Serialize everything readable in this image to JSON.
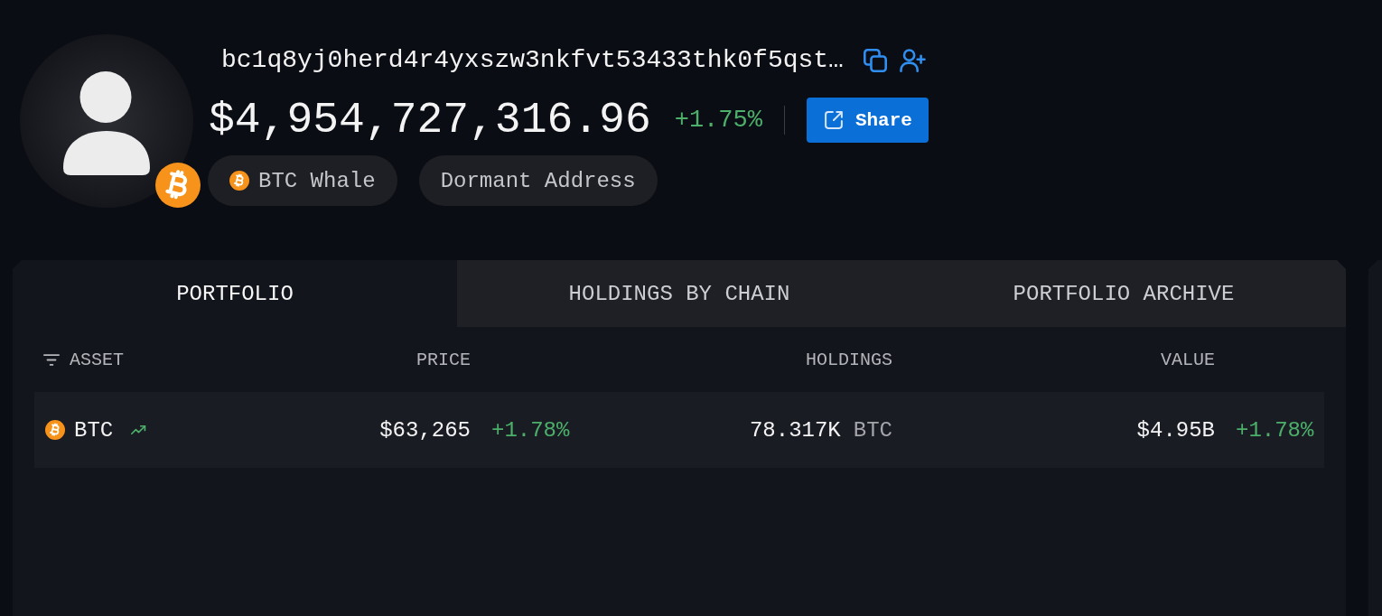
{
  "profile": {
    "address": "bc1q8yj0herd4r4yxszw3nkfvt53433thk0f5qst…",
    "balance": "$4,954,727,316.96",
    "change": "+1.75%",
    "share_button": "Share",
    "tags": [
      {
        "label": "BTC Whale",
        "kind": "coin"
      },
      {
        "label": "Dormant Address",
        "kind": "plain"
      }
    ]
  },
  "tabs": [
    {
      "label": "PORTFOLIO",
      "selected": true
    },
    {
      "label": "HOLDINGS BY CHAIN",
      "selected": false
    },
    {
      "label": "PORTFOLIO ARCHIVE",
      "selected": false
    }
  ],
  "table": {
    "columns": [
      {
        "label": "ASSET",
        "kind": "filter"
      },
      {
        "label": "PRICE",
        "kind": "plain"
      },
      {
        "label": "HOLDINGS",
        "kind": "plain"
      },
      {
        "label": "VALUE",
        "kind": "plain"
      }
    ],
    "rows": [
      {
        "asset": "BTC",
        "trending_up": true,
        "price": "$63,265",
        "price_change": "+1.78%",
        "holdings": "78.317K",
        "holdings_unit": "BTC",
        "value": "$4.95B",
        "value_change": "+1.78%"
      }
    ]
  }
}
